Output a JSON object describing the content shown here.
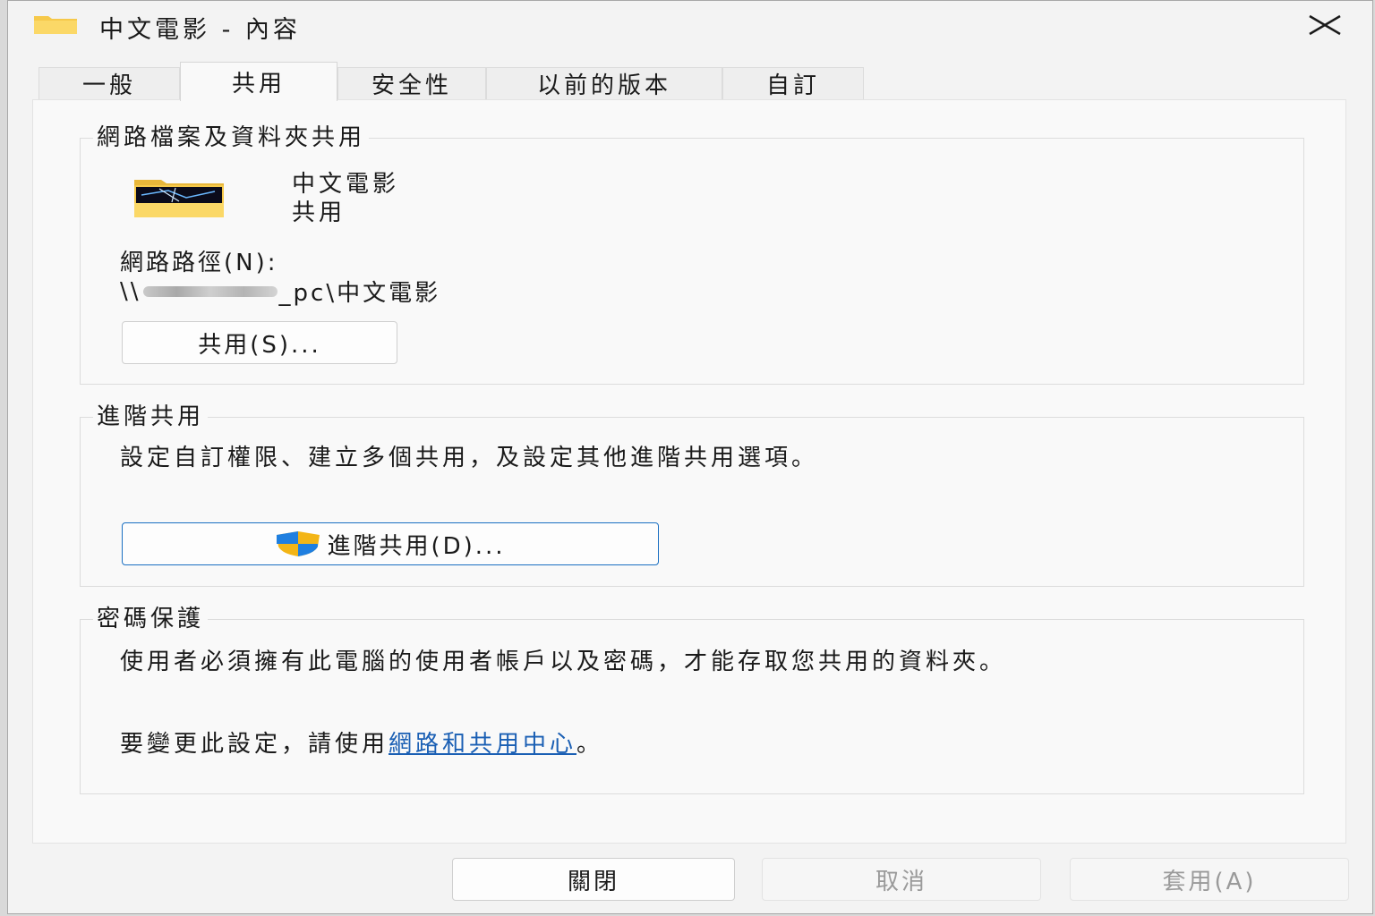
{
  "window": {
    "title": "中文電影 - 內容",
    "close_icon": "close-icon"
  },
  "tabs": [
    {
      "label": "一般",
      "active": false
    },
    {
      "label": "共用",
      "active": true
    },
    {
      "label": "安全性",
      "active": false
    },
    {
      "label": "以前的版本",
      "active": false
    },
    {
      "label": "自訂",
      "active": false
    }
  ],
  "network_sharing": {
    "legend": "網路檔案及資料夾共用",
    "folder_name": "中文電影",
    "share_state": "共用",
    "path_label": "網路路徑(N):",
    "path_prefix": "\\\\",
    "path_suffix": "_pc\\中文電影",
    "share_button": "共用(S)..."
  },
  "advanced_sharing": {
    "legend": "進階共用",
    "description": "設定自訂權限、建立多個共用，及設定其他進階共用選項。",
    "button": "進階共用(D)...",
    "button_icon": "uac-shield-icon"
  },
  "password_protection": {
    "legend": "密碼保護",
    "description": "使用者必須擁有此電腦的使用者帳戶以及密碼，才能存取您共用的資料夾。",
    "change_prefix": "要變更此設定，請使用",
    "change_link": "網路和共用中心",
    "change_suffix": "。"
  },
  "footer": {
    "close_label": "關閉",
    "cancel_label": "取消",
    "apply_label": "套用(A)"
  },
  "colors": {
    "accent": "#1a6fc2",
    "link": "#1a5fb4",
    "folder": "#f6c94a"
  }
}
